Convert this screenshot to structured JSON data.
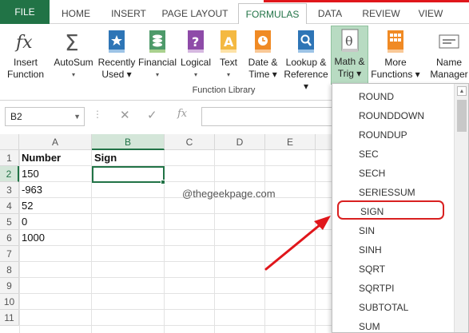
{
  "ribbon_tabs": [
    "FILE",
    "HOME",
    "INSERT",
    "PAGE LAYOUT",
    "FORMULAS",
    "DATA",
    "REVIEW",
    "VIEW"
  ],
  "active_tab": "FORMULAS",
  "ribbon_buttons": {
    "insert_function": [
      "Insert",
      "Function"
    ],
    "autosum": [
      "AutoSum",
      "▾"
    ],
    "recently_used": [
      "Recently",
      "Used ▾"
    ],
    "financial": [
      "Financial",
      "▾"
    ],
    "logical": [
      "Logical",
      "▾"
    ],
    "text": [
      "Text",
      "▾"
    ],
    "date_time": [
      "Date &",
      "Time ▾"
    ],
    "lookup_reference": [
      "Lookup &",
      "Reference ▾"
    ],
    "math_trig": [
      "Math &",
      "Trig ▾"
    ],
    "more_functions": [
      "More",
      "Functions ▾"
    ],
    "name_manager": [
      "Name",
      "Manager"
    ]
  },
  "group_label": "Function Library",
  "name_box": "B2",
  "fx_symbol": "fx",
  "columns": [
    "A",
    "B",
    "C",
    "D",
    "E"
  ],
  "selected_column": "B",
  "rows": [
    "1",
    "2",
    "3",
    "4",
    "5",
    "6",
    "7",
    "8",
    "9",
    "10",
    "11"
  ],
  "selected_row": "2",
  "cells": {
    "a1": "Number",
    "b1": "Sign",
    "a2": "150",
    "a3": "-963",
    "a4": "52",
    "a5": "0",
    "a6": "1000"
  },
  "watermark": "@thegeekpage.com",
  "dropdown_items": [
    "ROUND",
    "ROUNDDOWN",
    "ROUNDUP",
    "SEC",
    "SECH",
    "SERIESSUM",
    "SIGN",
    "SIN",
    "SINH",
    "SQRT",
    "SQRTPI",
    "SUBTOTAL",
    "SUM"
  ],
  "highlighted_item": "SIGN",
  "colors": {
    "excel_green": "#217346",
    "highlight_red": "#d92020"
  }
}
